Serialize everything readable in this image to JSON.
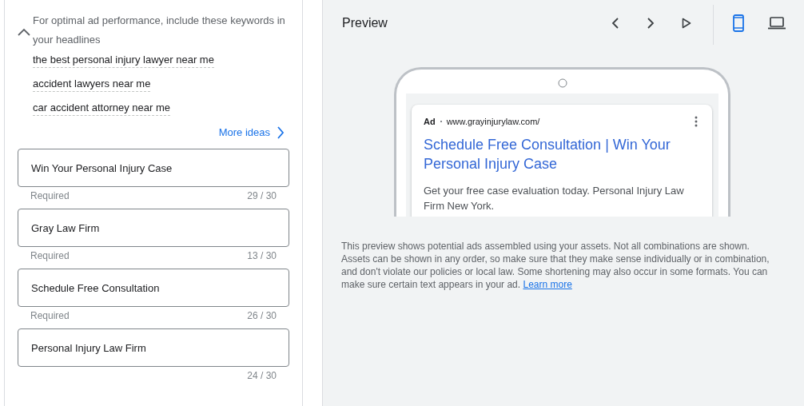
{
  "keywords_panel": {
    "expanded": true,
    "message": "For optimal ad performance, include these keywords in your headlines",
    "keywords": [
      "the best personal injury lawyer near me",
      "accident lawyers near me",
      "car accident attorney near me"
    ],
    "more_ideas": "More ideas"
  },
  "headlines": [
    {
      "value": "Win Your Personal Injury Case",
      "hint": "Required",
      "count": "29 / 30"
    },
    {
      "value": "Gray Law Firm",
      "hint": "Required",
      "count": "13 / 30"
    },
    {
      "value": "Schedule Free Consultation",
      "hint": "Required",
      "count": "26 / 30"
    },
    {
      "value": "Personal Injury Law Firm",
      "count": "24 / 30"
    }
  ],
  "preview": {
    "title": "Preview",
    "devices": [
      {
        "kind": "mobile",
        "selected": true
      },
      {
        "kind": "desktop",
        "selected": false
      }
    ],
    "ad": {
      "badge": "Ad",
      "url": "www.grayinjurylaw.com/",
      "headline": "Schedule Free Consultation | Win Your Personal Injury Case",
      "description": "Get your free case evaluation today. Personal Injury Law Firm New York."
    },
    "note": "This preview shows potential ads assembled using your assets. Not all combinations are shown. Assets can be shown in any order, so make sure that they make sense individually or in combination, and don't violate our policies or local law. Some shortening may also occur in some formats. You can make sure certain text appears in your ad.",
    "learn_more": "Learn more"
  }
}
